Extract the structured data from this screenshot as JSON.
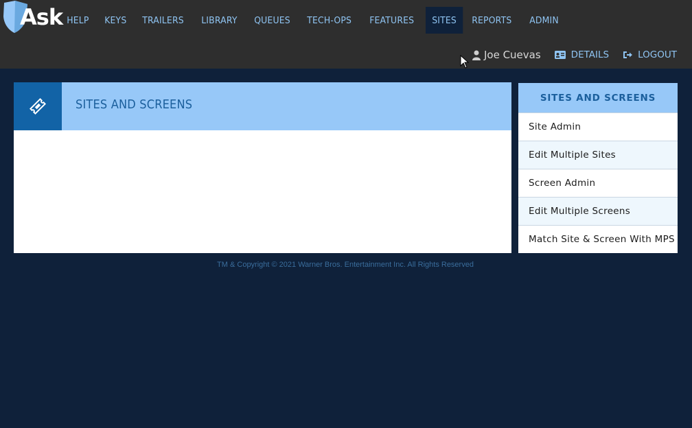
{
  "header": {
    "logo_text": "Ask",
    "nav": [
      {
        "label": "HELP",
        "active": false
      },
      {
        "label": "KEYS",
        "active": false
      },
      {
        "label": "TRAILERS",
        "active": false
      },
      {
        "label": "LIBRARY",
        "active": false
      },
      {
        "label": "QUEUES",
        "active": false
      },
      {
        "label": "TECH-OPS",
        "active": false
      },
      {
        "label": "FEATURES",
        "active": false
      },
      {
        "label": "SITES",
        "active": true
      },
      {
        "label": "REPORTS",
        "active": false
      },
      {
        "label": "ADMIN",
        "active": false
      }
    ],
    "user": {
      "name": "Joe Cuevas",
      "details_label": "DETAILS",
      "logout_label": "LOGOUT"
    }
  },
  "main": {
    "title": "SITES AND SCREENS"
  },
  "sidebar": {
    "title": "SITES AND SCREENS",
    "items": [
      {
        "label": "Site Admin"
      },
      {
        "label": "Edit Multiple Sites"
      },
      {
        "label": "Screen Admin"
      },
      {
        "label": "Edit Multiple Screens"
      },
      {
        "label": "Match Site & Screen With MPS"
      }
    ]
  },
  "footer": {
    "copyright": "TM & Copyright © 2021 Warner Bros. Entertainment Inc. All Rights Reserved"
  },
  "colors": {
    "background": "#0f213a",
    "header": "#2e2e2e",
    "nav_text": "#8fc4f2",
    "panel_header": "#97c8f8",
    "icon_box": "#1263a6",
    "title_text": "#1b5f9c"
  }
}
